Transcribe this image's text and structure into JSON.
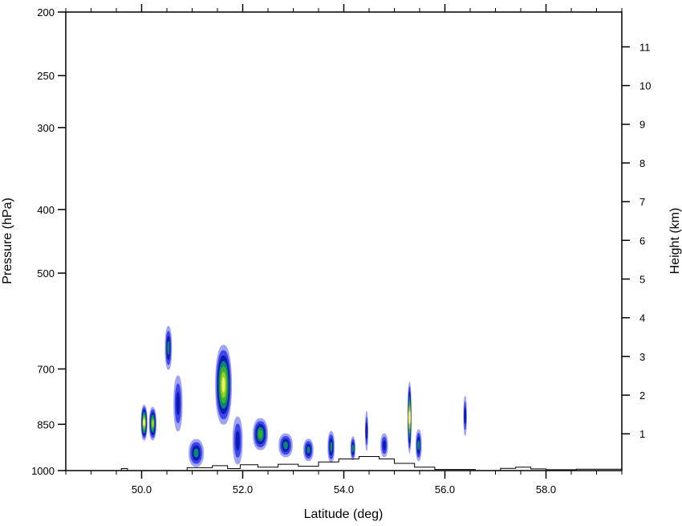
{
  "chart_data": {
    "type": "contour",
    "xlabel": "Latitude (deg)",
    "ylabel_left": "Pressure (hPa)",
    "ylabel_right": "Height (km)",
    "xlim": [
      48.5,
      59.5
    ],
    "ylim_pressure": [
      1000,
      200
    ],
    "ylim_height_km": [
      0.05,
      11.9
    ],
    "y_scale": "log",
    "grid": false,
    "legend": "none",
    "x_ticks": [
      {
        "value": 50,
        "label": "50.0"
      },
      {
        "value": 52,
        "label": "52.0"
      },
      {
        "value": 54,
        "label": "54.0"
      },
      {
        "value": 56,
        "label": "56.0"
      },
      {
        "value": 58,
        "label": "58.0"
      }
    ],
    "pressure_ticks": [
      {
        "value": 200,
        "label": "200"
      },
      {
        "value": 250,
        "label": "250"
      },
      {
        "value": 300,
        "label": "300"
      },
      {
        "value": 400,
        "label": "400"
      },
      {
        "value": 500,
        "label": "500"
      },
      {
        "value": 700,
        "label": "700"
      },
      {
        "value": 850,
        "label": "850"
      },
      {
        "value": 1000,
        "label": "1000"
      }
    ],
    "height_ticks": [
      {
        "value": 1,
        "label": "1"
      },
      {
        "value": 2,
        "label": "2"
      },
      {
        "value": 3,
        "label": "3"
      },
      {
        "value": 4,
        "label": "4"
      },
      {
        "value": 5,
        "label": "5"
      },
      {
        "value": 6,
        "label": "6"
      },
      {
        "value": 7,
        "label": "7"
      },
      {
        "value": 8,
        "label": "8"
      },
      {
        "value": 9,
        "label": "9"
      },
      {
        "value": 10,
        "label": "10"
      },
      {
        "value": 11,
        "label": "11"
      }
    ],
    "level_colors": [
      "#a0a4f4",
      "#3c46ec",
      "#0e1ab4",
      "#08886e",
      "#3cb42a",
      "#a2d020",
      "#f0f060"
    ],
    "cells": [
      {
        "lat": 50.05,
        "p": 845,
        "lw": 0.13,
        "hp": 45,
        "peak": 7
      },
      {
        "lat": 50.22,
        "p": 848,
        "lw": 0.15,
        "hp": 42,
        "peak": 6
      },
      {
        "lat": 50.53,
        "p": 650,
        "lw": 0.14,
        "hp": 55,
        "peak": 4
      },
      {
        "lat": 50.72,
        "p": 790,
        "lw": 0.18,
        "hp": 70,
        "peak": 3
      },
      {
        "lat": 51.08,
        "p": 940,
        "lw": 0.3,
        "hp": 35,
        "peak": 4
      },
      {
        "lat": 51.62,
        "p": 740,
        "lw": 0.33,
        "hp": 100,
        "peak": 7
      },
      {
        "lat": 51.9,
        "p": 900,
        "lw": 0.2,
        "hp": 60,
        "peak": 3
      },
      {
        "lat": 52.35,
        "p": 880,
        "lw": 0.3,
        "hp": 40,
        "peak": 5
      },
      {
        "lat": 52.85,
        "p": 915,
        "lw": 0.28,
        "hp": 30,
        "peak": 4
      },
      {
        "lat": 53.3,
        "p": 930,
        "lw": 0.2,
        "hp": 28,
        "peak": 4
      },
      {
        "lat": 53.75,
        "p": 920,
        "lw": 0.14,
        "hp": 40,
        "peak": 4
      },
      {
        "lat": 54.18,
        "p": 925,
        "lw": 0.1,
        "hp": 30,
        "peak": 4
      },
      {
        "lat": 54.45,
        "p": 870,
        "lw": 0.06,
        "hp": 50,
        "peak": 3
      },
      {
        "lat": 54.8,
        "p": 915,
        "lw": 0.15,
        "hp": 30,
        "peak": 3
      },
      {
        "lat": 55.3,
        "p": 830,
        "lw": 0.08,
        "hp": 90,
        "peak": 7
      },
      {
        "lat": 55.48,
        "p": 915,
        "lw": 0.12,
        "hp": 40,
        "peak": 4
      },
      {
        "lat": 56.4,
        "p": 825,
        "lw": 0.07,
        "hp": 50,
        "peak": 3
      }
    ],
    "terrain": [
      {
        "lat": 48.5,
        "p": 1000
      },
      {
        "lat": 49.6,
        "p": 1000
      },
      {
        "lat": 49.6,
        "p": 993
      },
      {
        "lat": 49.72,
        "p": 993
      },
      {
        "lat": 49.72,
        "p": 1000
      },
      {
        "lat": 50.9,
        "p": 1000
      },
      {
        "lat": 50.9,
        "p": 990
      },
      {
        "lat": 51.4,
        "p": 990
      },
      {
        "lat": 51.4,
        "p": 983
      },
      {
        "lat": 51.7,
        "p": 983
      },
      {
        "lat": 51.7,
        "p": 993
      },
      {
        "lat": 51.95,
        "p": 993
      },
      {
        "lat": 51.95,
        "p": 980
      },
      {
        "lat": 52.3,
        "p": 980
      },
      {
        "lat": 52.3,
        "p": 988
      },
      {
        "lat": 52.7,
        "p": 988
      },
      {
        "lat": 52.7,
        "p": 978
      },
      {
        "lat": 53.1,
        "p": 978
      },
      {
        "lat": 53.1,
        "p": 985
      },
      {
        "lat": 53.5,
        "p": 985
      },
      {
        "lat": 53.5,
        "p": 970
      },
      {
        "lat": 53.9,
        "p": 970
      },
      {
        "lat": 53.9,
        "p": 960
      },
      {
        "lat": 54.3,
        "p": 960
      },
      {
        "lat": 54.3,
        "p": 952
      },
      {
        "lat": 54.7,
        "p": 952
      },
      {
        "lat": 54.7,
        "p": 960
      },
      {
        "lat": 55.0,
        "p": 960
      },
      {
        "lat": 55.0,
        "p": 975
      },
      {
        "lat": 55.4,
        "p": 975
      },
      {
        "lat": 55.4,
        "p": 988
      },
      {
        "lat": 55.8,
        "p": 988
      },
      {
        "lat": 55.8,
        "p": 996
      },
      {
        "lat": 56.6,
        "p": 996
      },
      {
        "lat": 56.6,
        "p": 1000
      },
      {
        "lat": 57.1,
        "p": 1000
      },
      {
        "lat": 57.1,
        "p": 992
      },
      {
        "lat": 57.4,
        "p": 992
      },
      {
        "lat": 57.4,
        "p": 988
      },
      {
        "lat": 57.7,
        "p": 988
      },
      {
        "lat": 57.7,
        "p": 994
      },
      {
        "lat": 58.0,
        "p": 994
      },
      {
        "lat": 58.0,
        "p": 997
      },
      {
        "lat": 58.6,
        "p": 997
      },
      {
        "lat": 58.6,
        "p": 995
      },
      {
        "lat": 59.5,
        "p": 995
      }
    ]
  }
}
